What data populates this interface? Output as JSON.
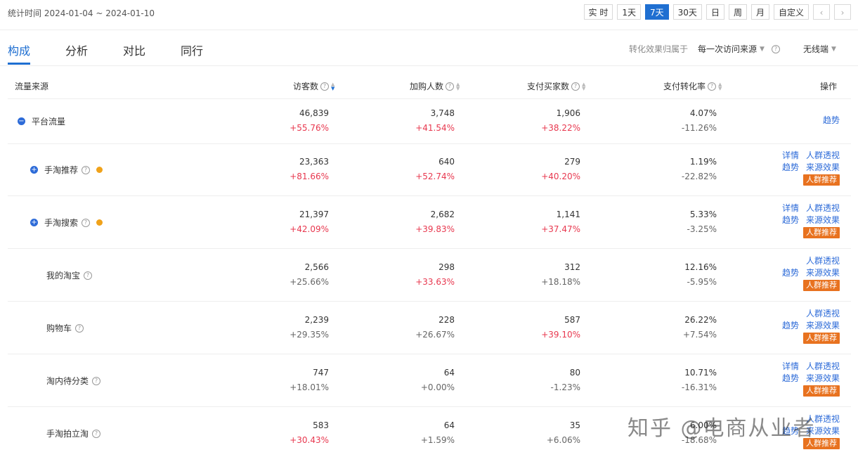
{
  "stat_range": "统计时间 2024-01-04 ~ 2024-01-10",
  "time_buttons": [
    "实 时",
    "1天",
    "7天",
    "30天",
    "日",
    "周",
    "月",
    "自定义"
  ],
  "tabs": [
    "构成",
    "分析",
    "对比",
    "同行"
  ],
  "attribution": {
    "label": "转化效果归属于",
    "value": "每一次访问来源",
    "device": "无线端"
  },
  "columns": [
    "流量来源",
    "访客数",
    "加购人数",
    "支付买家数",
    "支付转化率",
    "操作"
  ],
  "rows": [
    {
      "name": "平台流量",
      "visitors": "46,839",
      "visitors_chg": "+55.76%",
      "cart": "3,748",
      "cart_chg": "+41.54%",
      "buyers": "1,906",
      "buyers_chg": "+38.22%",
      "rate": "4.07%",
      "rate_chg": "-11.26%",
      "ops": [
        "趋势"
      ]
    },
    {
      "name": "手淘推荐",
      "visitors": "23,363",
      "visitors_chg": "+81.66%",
      "cart": "640",
      "cart_chg": "+52.74%",
      "buyers": "279",
      "buyers_chg": "+40.20%",
      "rate": "1.19%",
      "rate_chg": "-22.82%",
      "ops": [
        "详情",
        "人群透视",
        "趋势",
        "来源效果",
        "人群推荐"
      ]
    },
    {
      "name": "手淘搜索",
      "visitors": "21,397",
      "visitors_chg": "+42.09%",
      "cart": "2,682",
      "cart_chg": "+39.83%",
      "buyers": "1,141",
      "buyers_chg": "+37.47%",
      "rate": "5.33%",
      "rate_chg": "-3.25%",
      "ops": [
        "详情",
        "人群透视",
        "趋势",
        "来源效果",
        "人群推荐"
      ]
    },
    {
      "name": "我的淘宝",
      "visitors": "2,566",
      "visitors_chg": "+25.66%",
      "cart": "298",
      "cart_chg": "+33.63%",
      "buyers": "312",
      "buyers_chg": "+18.18%",
      "rate": "12.16%",
      "rate_chg": "-5.95%",
      "ops": [
        "人群透视",
        "趋势",
        "来源效果",
        "人群推荐"
      ]
    },
    {
      "name": "购物车",
      "visitors": "2,239",
      "visitors_chg": "+29.35%",
      "cart": "228",
      "cart_chg": "+26.67%",
      "buyers": "587",
      "buyers_chg": "+39.10%",
      "rate": "26.22%",
      "rate_chg": "+7.54%",
      "ops": [
        "人群透视",
        "趋势",
        "来源效果",
        "人群推荐"
      ]
    },
    {
      "name": "淘内待分类",
      "visitors": "747",
      "visitors_chg": "+18.01%",
      "cart": "64",
      "cart_chg": "+0.00%",
      "buyers": "80",
      "buyers_chg": "-1.23%",
      "rate": "10.71%",
      "rate_chg": "-16.31%",
      "ops": [
        "详情",
        "人群透视",
        "趋势",
        "来源效果",
        "人群推荐"
      ]
    },
    {
      "name": "手淘拍立淘",
      "visitors": "583",
      "visitors_chg": "+30.43%",
      "cart": "64",
      "cart_chg": "+1.59%",
      "buyers": "35",
      "buyers_chg": "+6.06%",
      "rate": "6.00%",
      "rate_chg": "-18.68%",
      "ops": [
        "人群透视",
        "趋势",
        "来源效果",
        "人群推荐"
      ]
    }
  ],
  "watermark": "知乎 @电商从业者"
}
